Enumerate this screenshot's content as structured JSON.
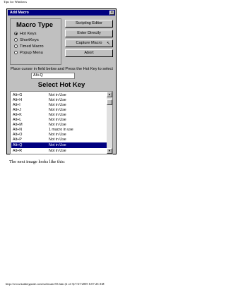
{
  "page": {
    "header": "Tips for Windows",
    "caption": "The next image looks like this:",
    "footer": "http://www.kathergasite.com/softwam/55.htm (2 of 3)/7/27/2005 6:07:26 AM"
  },
  "dialog": {
    "title": "Add Macro",
    "close_glyph": "×",
    "macro_type": {
      "title": "Macro Type",
      "options": [
        {
          "label": "Hot Keys",
          "checked": true
        },
        {
          "label": "ShortKeys",
          "checked": false
        },
        {
          "label": "Timed Macro",
          "checked": false
        },
        {
          "label": "Popup Menu",
          "checked": false
        }
      ]
    },
    "buttons": {
      "scripting_editor": "Scripting Editor",
      "enter_directly": "Enter Directly",
      "capture_macro": "Capture Macro",
      "abort": "Abort"
    },
    "instruction": "Place cursor in field below and Press the Hot Key to select",
    "hotkey_value": "Alt+Q",
    "list_title": "Select Hot Key",
    "rows": [
      {
        "key": "Alt+G",
        "status": "Not in Use"
      },
      {
        "key": "Alt+H",
        "status": "Not in Use"
      },
      {
        "key": "Alt+I",
        "status": "Not in Use"
      },
      {
        "key": "Alt+J",
        "status": "Not in Use"
      },
      {
        "key": "Alt+K",
        "status": "Not in Use"
      },
      {
        "key": "Alt+L",
        "status": "Not in Use"
      },
      {
        "key": "Alt+M",
        "status": "Not in Use"
      },
      {
        "key": "Alt+N",
        "status": "1 macro in use"
      },
      {
        "key": "Alt+O",
        "status": "Not in Use"
      },
      {
        "key": "Alt+P",
        "status": "Not in Use"
      },
      {
        "key": "Alt+Q",
        "status": "Not in Use",
        "selected": true
      },
      {
        "key": "Alt+R",
        "status": "Not in Use"
      }
    ],
    "scroll_up_glyph": "▲",
    "scroll_down_glyph": "▼",
    "cursor_glyph": "↖"
  }
}
